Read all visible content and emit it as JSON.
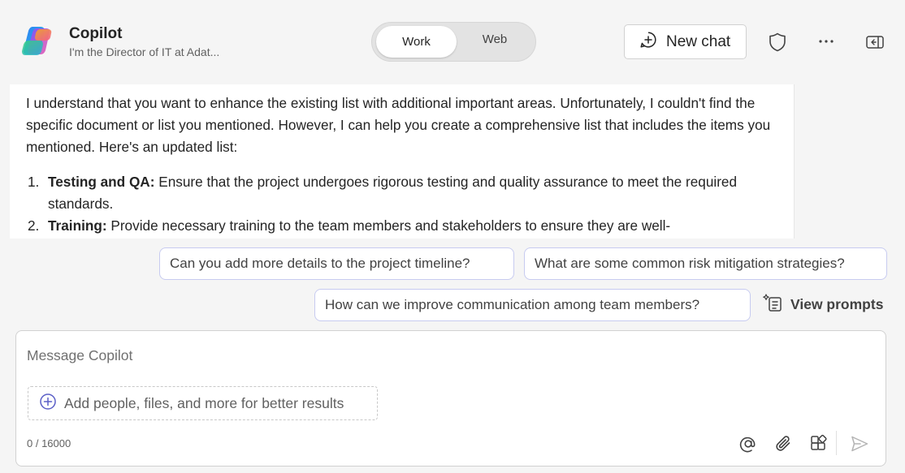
{
  "header": {
    "title": "Copilot",
    "subtitle": "I'm the Director of IT at Adat...",
    "mode_toggle": {
      "options": [
        "Work",
        "Web"
      ],
      "selected": "Work"
    },
    "new_chat_label": "New chat",
    "icons": [
      "copilot-logo",
      "plus-chat-icon",
      "shield-icon",
      "more-icon",
      "sidebar-toggle-icon"
    ]
  },
  "message": {
    "paragraph": "I understand that you want to enhance the existing list with additional important areas. Unfortunately, I couldn't find the specific document or list you mentioned. However, I can help you create a comprehensive list that includes the items you mentioned. Here's an updated list:",
    "items": [
      {
        "number": "1.",
        "title": "Testing and QA:",
        "text": "Ensure that the project undergoes rigorous testing and quality assurance to meet the required standards."
      },
      {
        "number": "2.",
        "title": "Training:",
        "text": "Provide necessary training to the team members and stakeholders to ensure they are well-"
      }
    ]
  },
  "suggestions": [
    "Can you add more details to the project timeline?",
    "What are some common risk mitigation strategies?",
    "How can we improve communication among team members?"
  ],
  "view_prompts_label": "View prompts",
  "composer": {
    "placeholder": "Message Copilot",
    "value": "",
    "add_context_label": "Add people, files, and more for better results",
    "char_count": "0 / 16000",
    "icons": [
      "mention-icon",
      "attach-icon",
      "apps-icon",
      "send-icon"
    ]
  },
  "colors": {
    "background": "#f5f5f5",
    "chip_border": "#c7cbf0",
    "accent": "#5b5fc7"
  }
}
